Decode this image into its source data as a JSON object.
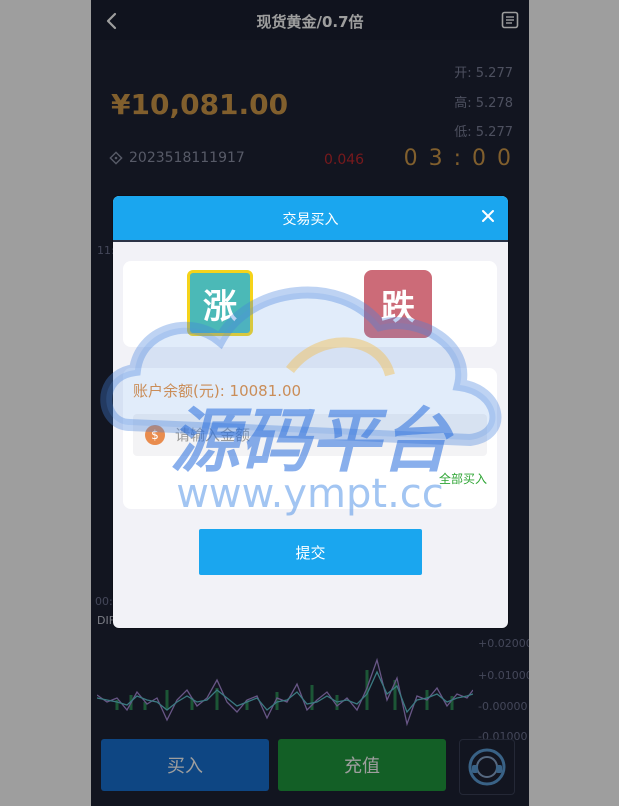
{
  "header": {
    "title": "现货黄金/0.7倍"
  },
  "quote": {
    "price": "¥10,081.00",
    "open": "开: 5.277",
    "high": "高: 5.278",
    "low": "低: 5.277",
    "order_no": "2023518111917",
    "change": "0.046",
    "countdown": "0 3 : 0 0"
  },
  "chart": {
    "time_label": "11:",
    "macd_label": "DIF",
    "x_label": "00:",
    "right_ticks": [
      "+0.02000",
      "+0.01000",
      "-0.00000",
      "-0.01000"
    ]
  },
  "modal": {
    "title": "交易买入",
    "up_label": "涨",
    "down_label": "跌",
    "balance": "账户余额(元): 10081.00",
    "amount_placeholder": "请输入金额",
    "buy_all": "全部买入",
    "submit": "提交"
  },
  "footer": {
    "buy": "买入",
    "charge": "充值"
  },
  "watermark": {
    "cn": "源码平台",
    "url": "www.ympt.cc"
  },
  "colors": {
    "accent": "#1aa6ef",
    "gold": "#d19a49",
    "up": "#4bb9b7",
    "down": "#cc6b78"
  }
}
